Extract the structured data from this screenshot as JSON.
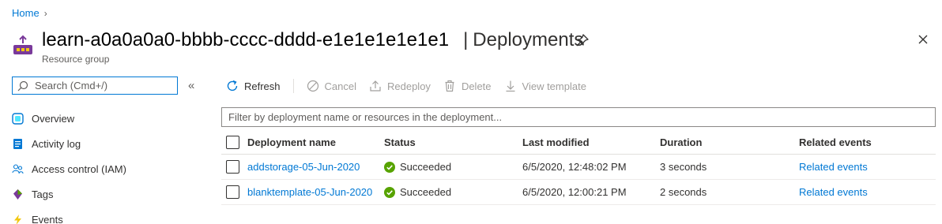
{
  "breadcrumb": {
    "home": "Home"
  },
  "header": {
    "resource_name": "learn-a0a0a0a0-bbbb-cccc-dddd-e1e1e1e1e1e1",
    "separator": "|",
    "page_title": "Deployments",
    "subtitle": "Resource group"
  },
  "search": {
    "placeholder": "Search (Cmd+/)"
  },
  "nav": {
    "items": [
      {
        "label": "Overview",
        "icon": "overview-icon"
      },
      {
        "label": "Activity log",
        "icon": "activity-log-icon"
      },
      {
        "label": "Access control (IAM)",
        "icon": "people-icon"
      },
      {
        "label": "Tags",
        "icon": "tag-icon"
      },
      {
        "label": "Events",
        "icon": "lightning-icon"
      }
    ]
  },
  "toolbar": {
    "refresh": "Refresh",
    "cancel": "Cancel",
    "redeploy": "Redeploy",
    "delete": "Delete",
    "view_template": "View template"
  },
  "filter": {
    "placeholder": "Filter by deployment name or resources in the deployment..."
  },
  "table": {
    "columns": [
      "Deployment name",
      "Status",
      "Last modified",
      "Duration",
      "Related events"
    ],
    "rows": [
      {
        "name": "addstorage-05-Jun-2020",
        "status": "Succeeded",
        "modified": "6/5/2020, 12:48:02 PM",
        "duration": "3 seconds",
        "events": "Related events"
      },
      {
        "name": "blanktemplate-05-Jun-2020",
        "status": "Succeeded",
        "modified": "6/5/2020, 12:00:21 PM",
        "duration": "2 seconds",
        "events": "Related events"
      }
    ]
  },
  "colors": {
    "link": "#0078d4",
    "success": "#57a300",
    "resource_group": "#7a3a9a"
  }
}
